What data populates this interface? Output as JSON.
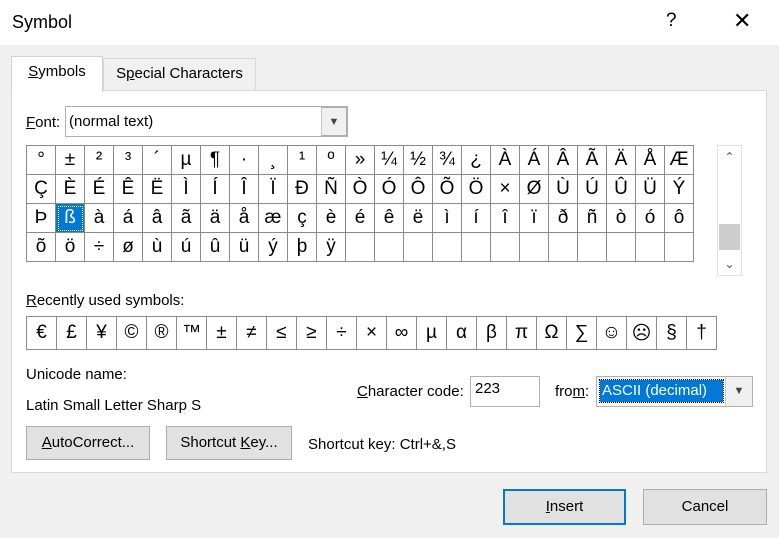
{
  "dialog": {
    "title": "Symbol",
    "help": "?",
    "close": "✕"
  },
  "tabs": [
    {
      "label": "Symbols",
      "mnemonic": "S",
      "rest": "ymbols",
      "active": true
    },
    {
      "label": "Special Characters",
      "pre": "S",
      "mnemonic": "p",
      "rest": "ecial Characters",
      "active": false
    }
  ],
  "font": {
    "label_mnemonic": "F",
    "label_rest": "ont:",
    "value": "(normal text)"
  },
  "symbol_grid": {
    "rows": [
      [
        "°",
        "±",
        "²",
        "³",
        "´",
        "µ",
        "¶",
        "·",
        "¸",
        "¹",
        "º",
        "»",
        "¼",
        "½",
        "¾",
        "¿",
        "À",
        "Á",
        "Â",
        "Ã",
        "Ä",
        "Å",
        "Æ"
      ],
      [
        "Ç",
        "È",
        "É",
        "Ê",
        "Ë",
        "Ì",
        "Í",
        "Î",
        "Ï",
        "Ð",
        "Ñ",
        "Ò",
        "Ó",
        "Ô",
        "Õ",
        "Ö",
        "×",
        "Ø",
        "Ù",
        "Ú",
        "Û",
        "Ü",
        "Ý"
      ],
      [
        "Þ",
        "ß",
        "à",
        "á",
        "â",
        "ã",
        "ä",
        "å",
        "æ",
        "ç",
        "è",
        "é",
        "ê",
        "ë",
        "ì",
        "í",
        "î",
        "ï",
        "ð",
        "ñ",
        "ò",
        "ó",
        "ô"
      ],
      [
        "õ",
        "ö",
        "÷",
        "ø",
        "ù",
        "ú",
        "û",
        "ü",
        "ý",
        "þ",
        "ÿ",
        "",
        "",
        "",
        "",
        "",
        "",
        "",
        "",
        "",
        "",
        "",
        ""
      ]
    ],
    "selected": {
      "row": 2,
      "col": 1
    },
    "scroll_up": "⌃",
    "scroll_down": "⌄"
  },
  "recent": {
    "label_mnemonic": "R",
    "label_rest": "ecently used symbols:",
    "symbols": [
      "€",
      "£",
      "¥",
      "©",
      "®",
      "™",
      "±",
      "≠",
      "≤",
      "≥",
      "÷",
      "×",
      "∞",
      "µ",
      "α",
      "β",
      "π",
      "Ω",
      "∑",
      "☺",
      "☹",
      "§",
      "†"
    ]
  },
  "unicode": {
    "label": "Unicode name:",
    "value": "Latin Small Letter Sharp S"
  },
  "char_code": {
    "label_mnemonic": "C",
    "label_rest": "haracter code:",
    "value": "223"
  },
  "from": {
    "label_pre": "fro",
    "label_mnemonic": "m",
    "label_rest": ":",
    "value": "ASCII (decimal)"
  },
  "buttons": {
    "autocorrect": {
      "mnemonic": "A",
      "rest": "utoCorrect..."
    },
    "shortcut_key": {
      "pre": "Shortcut ",
      "mnemonic": "K",
      "rest": "ey..."
    },
    "insert": {
      "mnemonic": "I",
      "rest": "nsert"
    },
    "cancel": "Cancel"
  },
  "shortcut_info": "Shortcut key: Ctrl+&,S"
}
